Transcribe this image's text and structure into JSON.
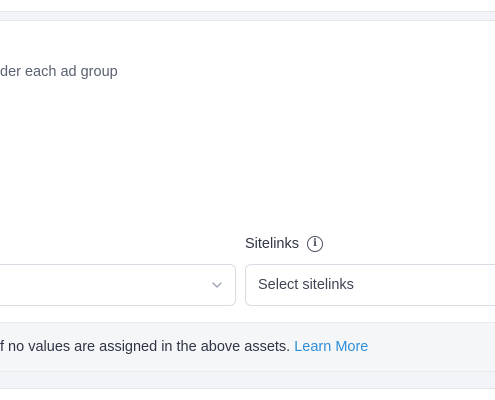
{
  "description": "der each ad group",
  "sitelinks": {
    "label": "Sitelinks",
    "info_icon": "info-icon",
    "placeholder": "Select sitelinks"
  },
  "left_select": {
    "value": "",
    "icon": "chevron-down-icon"
  },
  "note": {
    "text": "f no values are assigned in the above assets. ",
    "link": "Learn More"
  },
  "colors": {
    "link": "#2f8fd8",
    "border": "#d9dce3",
    "background": "#f3f4f7"
  }
}
